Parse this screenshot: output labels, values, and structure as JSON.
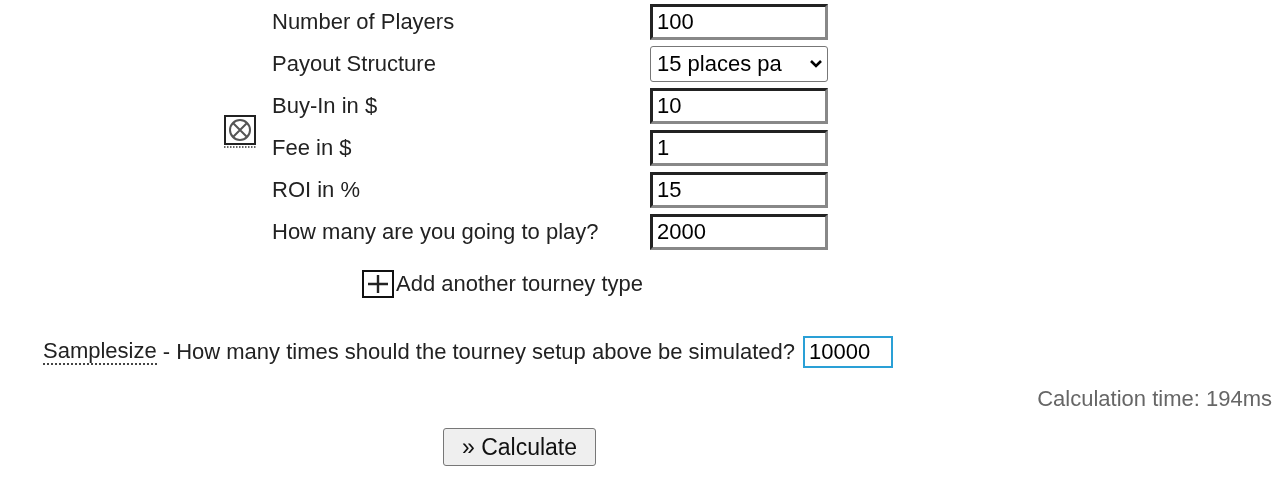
{
  "tourney_fields": [
    {
      "kind": "input",
      "label": "Number of Players",
      "value": "100"
    },
    {
      "kind": "select",
      "label": "Payout Structure",
      "value": "15 places pa"
    },
    {
      "kind": "input",
      "label": "Buy-In in $",
      "value": "10"
    },
    {
      "kind": "input",
      "label": "Fee in $",
      "value": "1"
    },
    {
      "kind": "input",
      "label": "ROI in %",
      "value": "15"
    },
    {
      "kind": "input",
      "label": "How many are you going to play?",
      "value": "2000"
    }
  ],
  "add_tourney": {
    "label": "Add another tourney type"
  },
  "samplesize": {
    "term": "Samplesize",
    "question": "- How many times should the tourney setup above be simulated?",
    "value": "10000",
    "focused": true
  },
  "calculation_time": "Calculation time: 194ms",
  "calculate_button": "» Calculate"
}
